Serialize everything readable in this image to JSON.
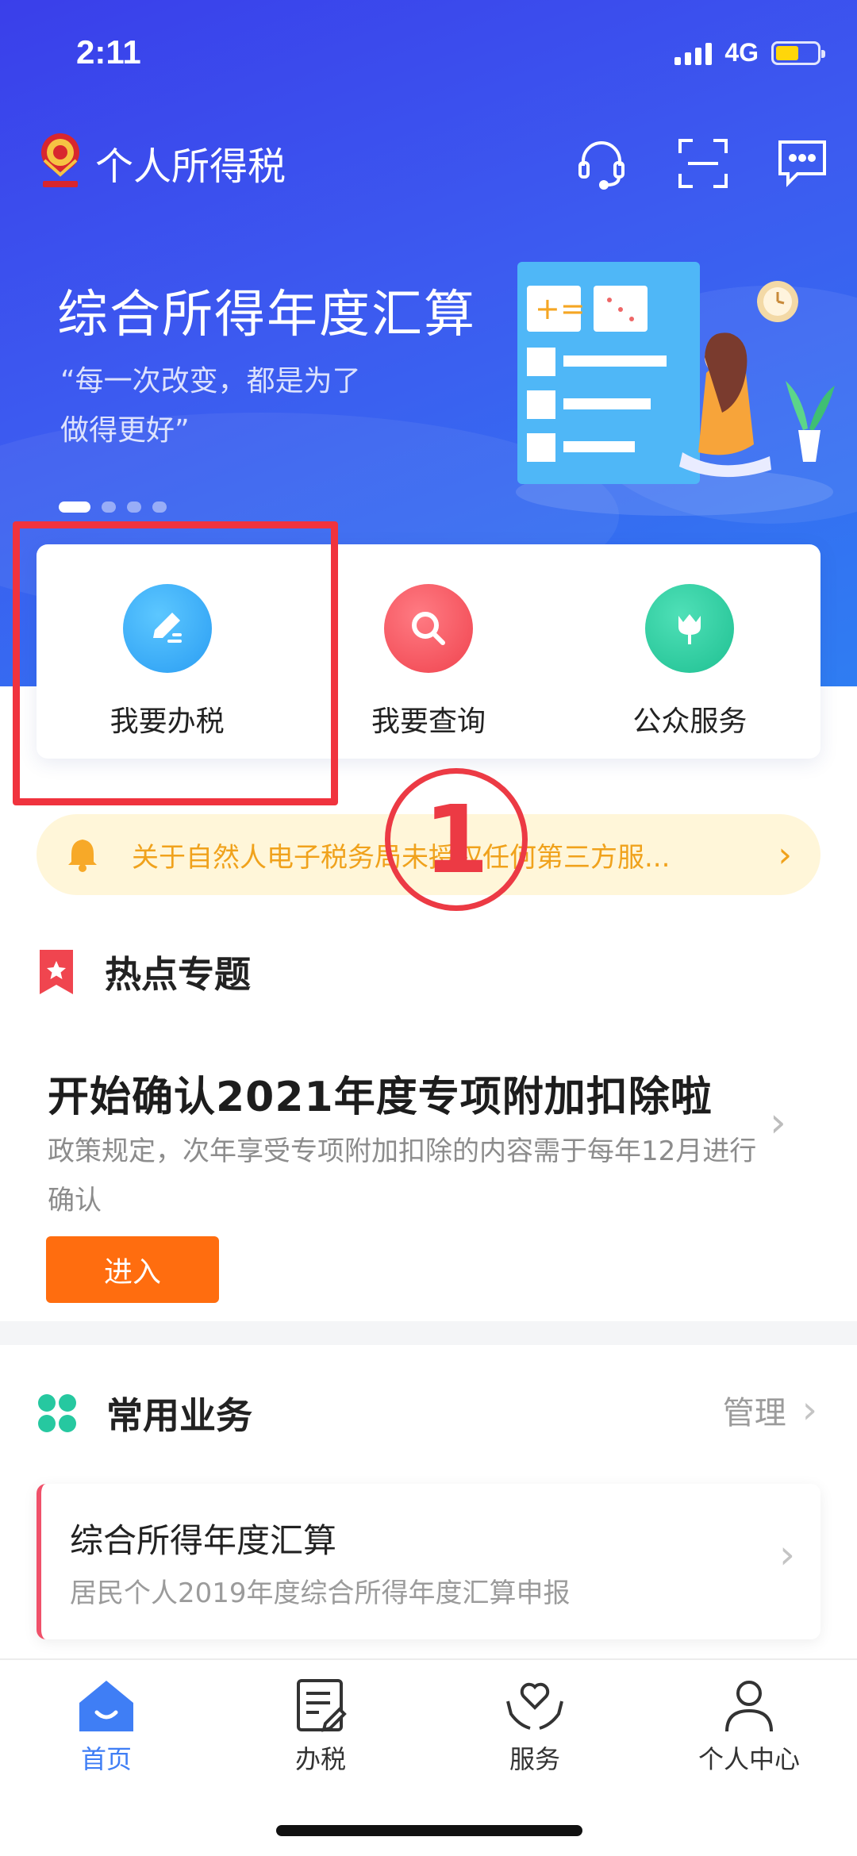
{
  "status_bar": {
    "time": "2:11",
    "network": "4G"
  },
  "header": {
    "app_title": "个人所得税"
  },
  "banner": {
    "title": "综合所得年度汇算",
    "subtitle_line1": "“每一次改变，都是为了",
    "subtitle_line2": "做得更好”",
    "slide_count": 4,
    "active_slide": 1
  },
  "actions": [
    {
      "label": "我要办税",
      "icon": "edit-icon",
      "color": "#2fa8f5"
    },
    {
      "label": "我要查询",
      "icon": "search-icon",
      "color": "#f5525c"
    },
    {
      "label": "公众服务",
      "icon": "tulip-icon",
      "color": "#22c9a0"
    }
  ],
  "annotation": {
    "number": "1"
  },
  "notice": {
    "text": "关于自然人电子税务局未授权任何第三方服..."
  },
  "hot_topics": {
    "section_title": "热点专题",
    "topic_title": "开始确认2021年度专项附加扣除啦",
    "topic_desc": "政策规定，次年享受专项附加扣除的内容需于每年12月进行确认",
    "enter_label": "进入"
  },
  "common_business": {
    "section_title": "常用业务",
    "manage_label": "管理",
    "item_title": "综合所得年度汇算",
    "item_sub": "居民个人2019年度综合所得年度汇算申报"
  },
  "tabs": [
    {
      "label": "首页",
      "icon": "home-icon",
      "active": true
    },
    {
      "label": "办税",
      "icon": "document-edit-icon",
      "active": false
    },
    {
      "label": "服务",
      "icon": "heart-hands-icon",
      "active": false
    },
    {
      "label": "个人中心",
      "icon": "person-icon",
      "active": false
    }
  ],
  "colors": {
    "hero_blue": "#3c5bf0",
    "accent_orange": "#ff6d0f",
    "highlight_red": "#f0333e",
    "tab_active": "#3f7ef5"
  }
}
